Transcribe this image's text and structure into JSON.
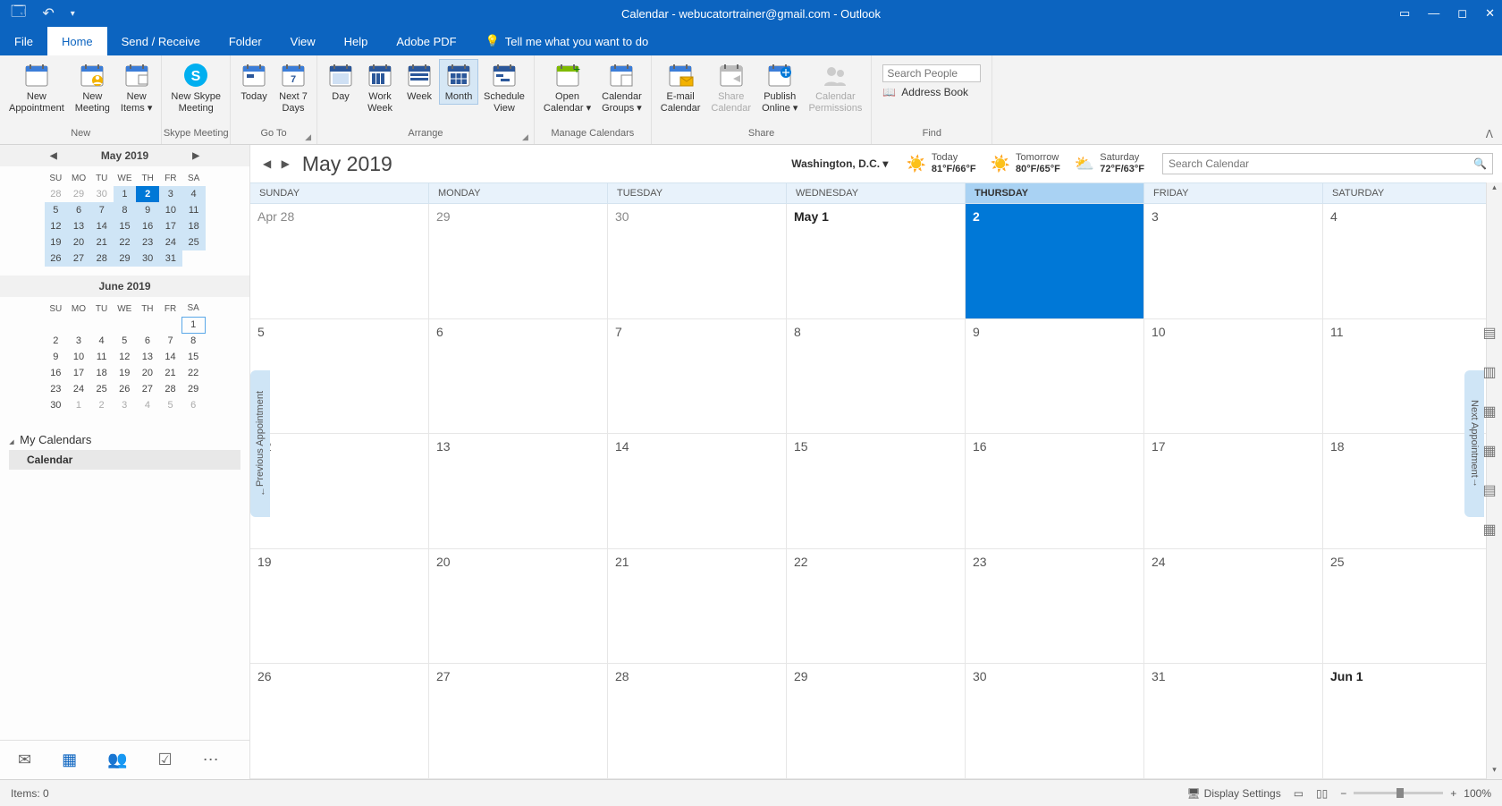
{
  "titlebar": {
    "title": "Calendar - webucatortrainer@gmail.com  -  Outlook"
  },
  "menu": {
    "tabs": [
      "File",
      "Home",
      "Send / Receive",
      "Folder",
      "View",
      "Help",
      "Adobe PDF"
    ],
    "active": 1,
    "tellme": "Tell me what you want to do"
  },
  "ribbon": {
    "groups": {
      "new": {
        "label": "New",
        "buttons": [
          {
            "l": "New\nAppointment"
          },
          {
            "l": "New\nMeeting"
          },
          {
            "l": "New\nItems ▾"
          }
        ]
      },
      "skype": {
        "label": "Skype Meeting",
        "buttons": [
          {
            "l": "New Skype\nMeeting"
          }
        ]
      },
      "goto": {
        "label": "Go To",
        "buttons": [
          {
            "l": "Today"
          },
          {
            "l": "Next 7\nDays"
          }
        ]
      },
      "arrange": {
        "label": "Arrange",
        "buttons": [
          {
            "l": "Day"
          },
          {
            "l": "Work\nWeek"
          },
          {
            "l": "Week"
          },
          {
            "l": "Month",
            "active": true
          },
          {
            "l": "Schedule\nView"
          }
        ]
      },
      "manage": {
        "label": "Manage Calendars",
        "buttons": [
          {
            "l": "Open\nCalendar ▾"
          },
          {
            "l": "Calendar\nGroups ▾"
          }
        ]
      },
      "share": {
        "label": "Share",
        "buttons": [
          {
            "l": "E-mail\nCalendar"
          },
          {
            "l": "Share\nCalendar",
            "disabled": true
          },
          {
            "l": "Publish\nOnline ▾"
          },
          {
            "l": "Calendar\nPermissions",
            "disabled": true
          }
        ]
      },
      "find": {
        "label": "Find",
        "search": "Search People",
        "addressbook": "Address Book"
      }
    }
  },
  "minicalendars": [
    {
      "title": "May 2019",
      "headers": [
        "SU",
        "MO",
        "TU",
        "WE",
        "TH",
        "FR",
        "SA"
      ],
      "rows": [
        [
          {
            "d": "28",
            "dim": true
          },
          {
            "d": "29",
            "dim": true
          },
          {
            "d": "30",
            "dim": true
          },
          {
            "d": "1",
            "r": true
          },
          {
            "d": "2",
            "r": true,
            "today": true
          },
          {
            "d": "3",
            "r": true
          },
          {
            "d": "4",
            "r": true
          }
        ],
        [
          {
            "d": "5",
            "r": true
          },
          {
            "d": "6",
            "r": true
          },
          {
            "d": "7",
            "r": true
          },
          {
            "d": "8",
            "r": true
          },
          {
            "d": "9",
            "r": true
          },
          {
            "d": "10",
            "r": true
          },
          {
            "d": "11",
            "r": true
          }
        ],
        [
          {
            "d": "12",
            "r": true
          },
          {
            "d": "13",
            "r": true
          },
          {
            "d": "14",
            "r": true
          },
          {
            "d": "15",
            "r": true
          },
          {
            "d": "16",
            "r": true
          },
          {
            "d": "17",
            "r": true
          },
          {
            "d": "18",
            "r": true
          }
        ],
        [
          {
            "d": "19",
            "r": true
          },
          {
            "d": "20",
            "r": true
          },
          {
            "d": "21",
            "r": true
          },
          {
            "d": "22",
            "r": true
          },
          {
            "d": "23",
            "r": true
          },
          {
            "d": "24",
            "r": true
          },
          {
            "d": "25",
            "r": true
          }
        ],
        [
          {
            "d": "26",
            "r": true
          },
          {
            "d": "27",
            "r": true
          },
          {
            "d": "28",
            "r": true
          },
          {
            "d": "29",
            "r": true
          },
          {
            "d": "30",
            "r": true
          },
          {
            "d": "31",
            "r": true
          },
          {
            "d": ""
          }
        ]
      ]
    },
    {
      "title": "June 2019",
      "headers": [
        "SU",
        "MO",
        "TU",
        "WE",
        "TH",
        "FR",
        "SA"
      ],
      "rows": [
        [
          {
            "d": ""
          },
          {
            "d": ""
          },
          {
            "d": ""
          },
          {
            "d": ""
          },
          {
            "d": ""
          },
          {
            "d": ""
          },
          {
            "d": "1",
            "box": true
          }
        ],
        [
          {
            "d": "2"
          },
          {
            "d": "3"
          },
          {
            "d": "4"
          },
          {
            "d": "5"
          },
          {
            "d": "6"
          },
          {
            "d": "7"
          },
          {
            "d": "8"
          }
        ],
        [
          {
            "d": "9"
          },
          {
            "d": "10"
          },
          {
            "d": "11"
          },
          {
            "d": "12"
          },
          {
            "d": "13"
          },
          {
            "d": "14"
          },
          {
            "d": "15"
          }
        ],
        [
          {
            "d": "16"
          },
          {
            "d": "17"
          },
          {
            "d": "18"
          },
          {
            "d": "19"
          },
          {
            "d": "20"
          },
          {
            "d": "21"
          },
          {
            "d": "22"
          }
        ],
        [
          {
            "d": "23"
          },
          {
            "d": "24"
          },
          {
            "d": "25"
          },
          {
            "d": "26"
          },
          {
            "d": "27"
          },
          {
            "d": "28"
          },
          {
            "d": "29"
          }
        ],
        [
          {
            "d": "30"
          },
          {
            "d": "1",
            "dim": true
          },
          {
            "d": "2",
            "dim": true
          },
          {
            "d": "3",
            "dim": true
          },
          {
            "d": "4",
            "dim": true
          },
          {
            "d": "5",
            "dim": true
          },
          {
            "d": "6",
            "dim": true
          }
        ]
      ]
    }
  ],
  "mycalendars": {
    "header": "My Calendars",
    "items": [
      "Calendar"
    ]
  },
  "calview": {
    "title": "May 2019",
    "location": "Washington,  D.C. ▾",
    "weather": [
      {
        "label": "Today",
        "temp": "81°F/66°F"
      },
      {
        "label": "Tomorrow",
        "temp": "80°F/65°F"
      },
      {
        "label": "Saturday",
        "temp": "72°F/63°F"
      }
    ],
    "search_placeholder": "Search Calendar",
    "day_headers": [
      "SUNDAY",
      "MONDAY",
      "TUESDAY",
      "WEDNESDAY",
      "THURSDAY",
      "FRIDAY",
      "SATURDAY"
    ],
    "today_col": 4,
    "rows": [
      [
        {
          "t": "Apr 28",
          "dim": true
        },
        {
          "t": "29",
          "dim": true
        },
        {
          "t": "30",
          "dim": true
        },
        {
          "t": "May 1",
          "bold": true
        },
        {
          "t": "2",
          "today": true
        },
        {
          "t": "3"
        },
        {
          "t": "4"
        }
      ],
      [
        {
          "t": "5"
        },
        {
          "t": "6"
        },
        {
          "t": "7"
        },
        {
          "t": "8"
        },
        {
          "t": "9"
        },
        {
          "t": "10"
        },
        {
          "t": "11"
        }
      ],
      [
        {
          "t": "12"
        },
        {
          "t": "13"
        },
        {
          "t": "14"
        },
        {
          "t": "15"
        },
        {
          "t": "16"
        },
        {
          "t": "17"
        },
        {
          "t": "18"
        }
      ],
      [
        {
          "t": "19"
        },
        {
          "t": "20"
        },
        {
          "t": "21"
        },
        {
          "t": "22"
        },
        {
          "t": "23"
        },
        {
          "t": "24"
        },
        {
          "t": "25"
        }
      ],
      [
        {
          "t": "26"
        },
        {
          "t": "27"
        },
        {
          "t": "28"
        },
        {
          "t": "29"
        },
        {
          "t": "30"
        },
        {
          "t": "31"
        },
        {
          "t": "Jun 1",
          "bold": true
        }
      ]
    ],
    "prev_appt": "Previous Appointment",
    "next_appt": "Next Appointment"
  },
  "status": {
    "items": "Items: 0",
    "display": "Display Settings",
    "zoom": "100%"
  }
}
